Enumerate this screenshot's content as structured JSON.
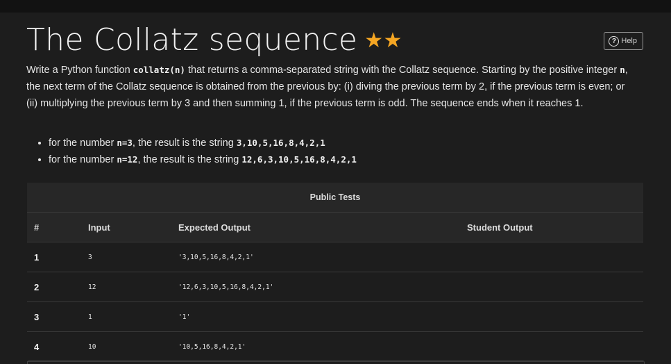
{
  "header": {
    "title": "The Collatz sequence",
    "stars": "★★",
    "help_label": "Help"
  },
  "description": {
    "p1": "Write a Python function ",
    "func": "collatz(n)",
    "p2": " that returns a comma-separated string with the Collatz sequence. Starting by the positive integer ",
    "var_n": "n",
    "p3": ", the next term of the Collatz sequence is obtained from the previous by: (i) diving the previous term by 2, if the previous term is even; or (ii) multiplying the previous term by 3 and then summing 1, if the previous term is odd. The sequence ends when it reaches 1."
  },
  "examples": [
    {
      "prefix": "for the number ",
      "arg": "n=3",
      "middle": ", the result is the string ",
      "result": "3,10,5,16,8,4,2,1"
    },
    {
      "prefix": "for the number ",
      "arg": "n=12",
      "middle": ", the result is the string ",
      "result": "12,6,3,10,5,16,8,4,2,1"
    }
  ],
  "tests": {
    "caption": "Public Tests",
    "columns": [
      "#",
      "Input",
      "Expected Output",
      "Student Output"
    ],
    "rows": [
      {
        "num": "1",
        "input": "3",
        "expected": "'3,10,5,16,8,4,2,1'",
        "student": ""
      },
      {
        "num": "2",
        "input": "12",
        "expected": "'12,6,3,10,5,16,8,4,2,1'",
        "student": ""
      },
      {
        "num": "3",
        "input": "1",
        "expected": "'1'",
        "student": ""
      },
      {
        "num": "4",
        "input": "10",
        "expected": "'10,5,16,8,4,2,1'",
        "student": ""
      }
    ]
  },
  "colors": {
    "background": "#1d1d1d",
    "accent_star": "#f5a623",
    "table_header": "#272727"
  },
  "icons": [
    "question-circle-icon",
    "star-icon"
  ]
}
